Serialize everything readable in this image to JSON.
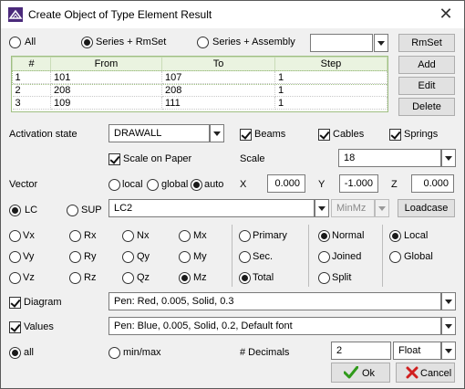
{
  "window": {
    "title": "Create Object of Type Element Result",
    "close": "✕"
  },
  "selection": {
    "all_label": "All",
    "series_rmset_label": "Series + RmSet",
    "series_assembly_label": "Series + Assembly",
    "selected": "series_rmset",
    "combo_value": ""
  },
  "side_buttons": {
    "rmset": "RmSet",
    "add": "Add",
    "edit": "Edit",
    "delete": "Delete"
  },
  "table": {
    "columns": [
      "#",
      "From",
      "To",
      "Step"
    ],
    "rows": [
      [
        "1",
        "101",
        "107",
        "1"
      ],
      [
        "2",
        "208",
        "208",
        "1"
      ],
      [
        "3",
        "109",
        "111",
        "1"
      ]
    ]
  },
  "activation": {
    "label": "Activation state",
    "value": "DRAWALL"
  },
  "element_types": {
    "beams": "Beams",
    "cables": "Cables",
    "springs": "Springs"
  },
  "scale": {
    "on_paper_label": "Scale on Paper",
    "label": "Scale",
    "value": "18"
  },
  "vector": {
    "label": "Vector",
    "local": "local",
    "global": "global",
    "auto": "auto",
    "selected": "auto",
    "x_label": "X",
    "x_value": "0.000",
    "y_label": "Y",
    "y_value": "-1.000",
    "z_label": "Z",
    "z_value": "0.000"
  },
  "loadcase": {
    "lc_label": "LC",
    "sup_label": "SUP",
    "value": "LC2",
    "minmax_value": "MinMz",
    "button": "Loadcase"
  },
  "components": {
    "col1": [
      "Vx",
      "Vy",
      "Vz"
    ],
    "col2": [
      "Rx",
      "Ry",
      "Rz"
    ],
    "col3": [
      "Nx",
      "Qy",
      "Qz"
    ],
    "col4": [
      "Mx",
      "My",
      "Mz"
    ],
    "selected": "Mz"
  },
  "display": {
    "options": [
      "Primary",
      "Sec.",
      "Total"
    ],
    "selected": "Total"
  },
  "mode": {
    "options": [
      "Normal",
      "Joined",
      "Split"
    ],
    "selected": "Normal"
  },
  "coord": {
    "options": [
      "Local",
      "Global"
    ],
    "selected": "Local"
  },
  "diagram": {
    "label": "Diagram",
    "value": "Pen: Red, 0.005, Solid, 0.3"
  },
  "values": {
    "label": "Values",
    "value": "Pen: Blue, 0.005, Solid, 0.2, Default font"
  },
  "range": {
    "all_label": "all",
    "minmax_label": "min/max",
    "selected": "all"
  },
  "decimals": {
    "label": "# Decimals",
    "value": "2",
    "format": "Float"
  },
  "footer": {
    "ok": "Ok",
    "cancel": "Cancel"
  }
}
